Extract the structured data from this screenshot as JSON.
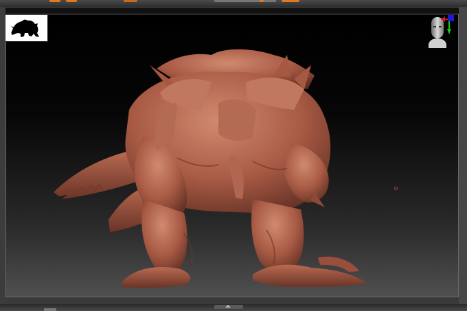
{
  "app": {
    "viewport": "zbrush-canvas",
    "model": "creature-sculpt"
  },
  "toolbar": {
    "widgets": [
      "orange-button",
      "orange-button",
      "slider-grip",
      "orange-button"
    ]
  },
  "colors": {
    "accent": "#e07a1f",
    "clay": "#a85a44",
    "canvas_top": "#000000",
    "canvas_bottom": "#505050",
    "gizmo_x": "#d41a1a",
    "gizmo_y": "#1ec81e",
    "gizmo_z": "#1c1cd8"
  },
  "icons": {
    "thumbnail": "creature-silhouette-icon",
    "navigation": "head-gizmo-icon",
    "collapse": "chevron-up-icon"
  }
}
